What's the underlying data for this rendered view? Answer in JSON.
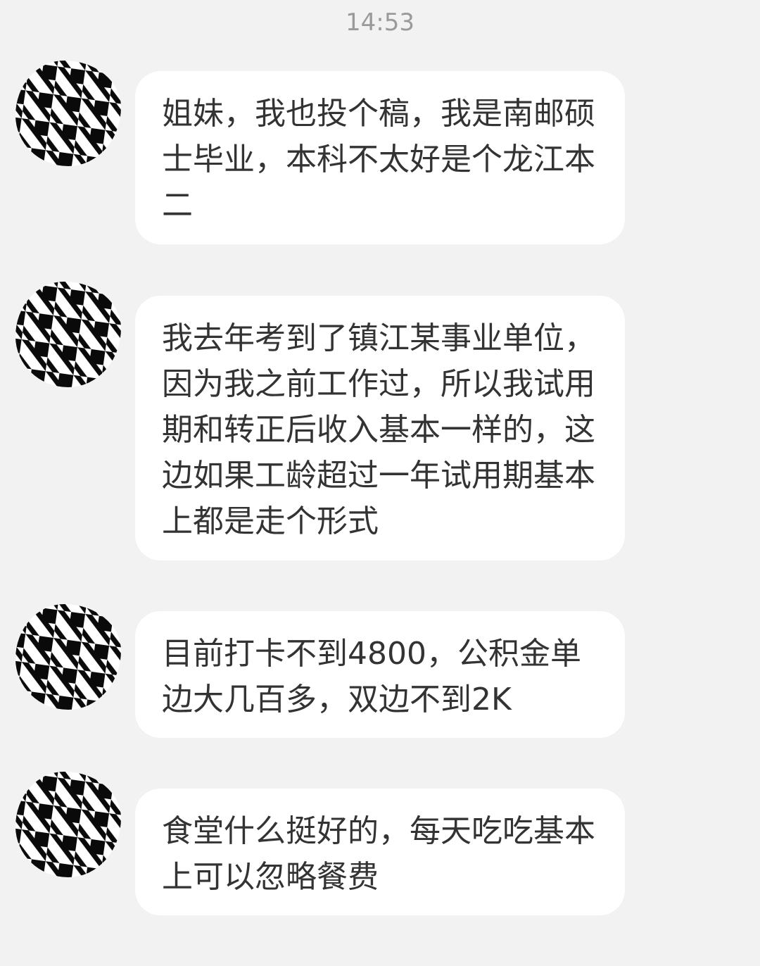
{
  "chat": {
    "timestamp": "14:53",
    "colors": {
      "background": "#f2f2f2",
      "bubble": "#ffffff",
      "text": "#333333",
      "timestamp": "#9a9a9a"
    },
    "messages": [
      {
        "avatar_icon": "houndstooth-avatar-icon",
        "text": "姐妹，我也投个稿，我是南邮硕士毕业，本科不太好是个龙江本二"
      },
      {
        "avatar_icon": "houndstooth-avatar-icon",
        "text": "我去年考到了镇江某事业单位，因为我之前工作过，所以我试用期和转正后收入基本一样的，这边如果工龄超过一年试用期基本上都是走个形式"
      },
      {
        "avatar_icon": "houndstooth-avatar-icon",
        "text": "目前打卡不到4800，公积金单边大几百多，双边不到2K"
      },
      {
        "avatar_icon": "houndstooth-avatar-icon",
        "text": "食堂什么挺好的，每天吃吃基本上可以忽略餐费"
      }
    ]
  }
}
